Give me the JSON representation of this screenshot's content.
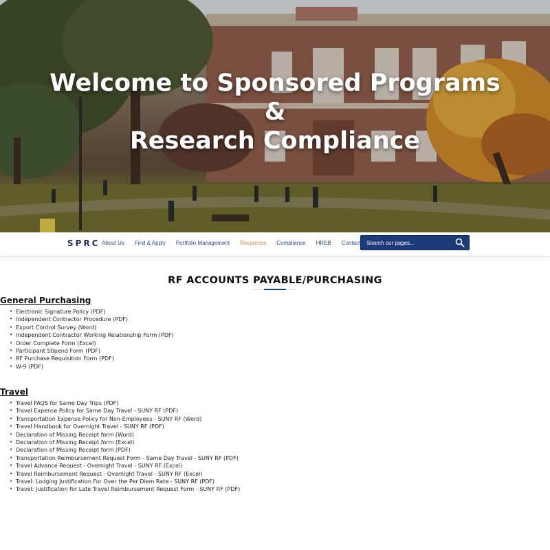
{
  "hero": {
    "title_line1": "Welcome to Sponsored Programs",
    "title_line2": "&",
    "title_line3": "Research Compliance"
  },
  "nav": {
    "brand": "SPRC",
    "links": [
      "About Us",
      "Find & Apply",
      "Portfolio Management",
      "Resources",
      "Compliance",
      "HREB",
      "Contact"
    ],
    "active_link": "Resources",
    "active_color": "#e07f4a",
    "search_placeholder": "Search our pages...",
    "search_icon": "search-icon",
    "accent_color": "#1c3a7a"
  },
  "page": {
    "title": "RF ACCOUNTS PAYABLE/PURCHASING"
  },
  "sections": [
    {
      "heading": "General Purchasing",
      "items": [
        "Electronic Signature Policy (PDF)",
        "Independent Contractor Procedure (PDF)",
        "Export Control Survey (Word)",
        "Independent Contractor Working Relationship Form (PDF)",
        "Order Complete Form (Excel)",
        "Participant Stipend Form (PDF)",
        "RF Purchase Requisition Form (PDF)",
        "W-9 (PDF)"
      ]
    },
    {
      "heading": "Travel",
      "items": [
        "Travel FAQS for Same Day Trips (PDF)",
        "Travel Expense Policy for Same Day Travel - SUNY RF (PDF)",
        "Transportation Expense Policy for Non-Employees - SUNY RF (Word)",
        "Travel Handbook for Overnight Travel - SUNY RF (PDF)",
        "Declaration of Missing Receipt form (Word)",
        "Declaration of Missing Receipt form (Excel)",
        "Declaration of Missing Receipt form (PDF)",
        "Transportation Reimbursement Request Form - Same Day Travel - SUNY RF (PDF)",
        "Travel Advance Request - Overnight Travel - SUNY RF (Excel)",
        "Travel Reimbursement Request - Overnight Travel - SUNY RF (Excel)",
        "Travel: Lodging Justification For Over the Per Diem Rate - SUNY RF (PDF)",
        "Travel: Justification for Late Travel Reimbursement Request Form - SUNY RF (PDF)"
      ]
    }
  ]
}
